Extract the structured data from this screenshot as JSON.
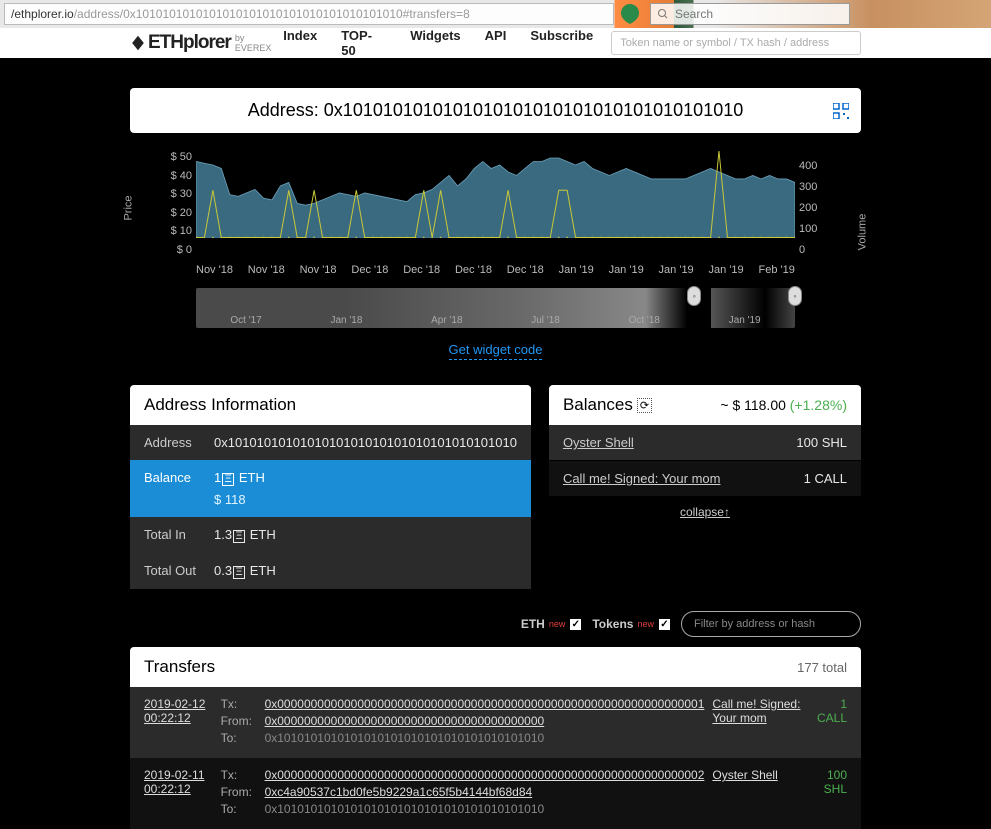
{
  "browser": {
    "url_prefix": "/ethplorer.io",
    "url_path": "/address/0x1010101010101010101010101010101010101010#transfers=8",
    "search_placeholder": "Search"
  },
  "nav": {
    "brand": "ETHplorer",
    "by": "by EVEREX",
    "items": [
      "Index",
      "TOP-50",
      "Widgets",
      "API",
      "Subscribe"
    ],
    "token_search": "Token name or symbol / TX hash / address"
  },
  "address_label": "Address:",
  "address": "0x1010101010101010101010101010101010101010",
  "widget_link": "Get widget code",
  "chart_data": {
    "type": "area+bar",
    "xlabel": "",
    "ylabel_left": "Price",
    "ylabel_right": "Volume",
    "y_left_ticks": [
      "$ 50",
      "$ 40",
      "$ 30",
      "$ 20",
      "$ 10",
      "$ 0"
    ],
    "y_right_ticks": [
      "400",
      "300",
      "200",
      "100",
      "0"
    ],
    "x_ticks": [
      "Nov '18",
      "Nov '18",
      "Nov '18",
      "Dec '18",
      "Dec '18",
      "Dec '18",
      "Dec '18",
      "Jan '19",
      "Jan '19",
      "Jan '19",
      "Jan '19",
      "Feb '19"
    ],
    "brush_ticks": [
      "Oct '17",
      "Jan '18",
      "Apr '18",
      "Jul '18",
      "Oct '18",
      "Jan '19"
    ],
    "price_series": [
      44,
      43,
      42,
      40,
      25,
      24,
      26,
      28,
      23,
      22,
      30,
      32,
      20,
      19,
      20,
      22,
      24,
      26,
      25,
      24,
      26,
      25,
      24,
      23,
      22,
      21,
      25,
      26,
      28,
      32,
      36,
      30,
      34,
      40,
      44,
      40,
      42,
      38,
      36,
      40,
      44,
      44,
      46,
      46,
      44,
      42,
      44,
      40,
      38,
      36,
      38,
      40,
      38,
      36,
      34,
      34,
      34,
      34,
      34,
      36,
      38,
      40,
      38,
      36,
      34,
      34,
      36,
      34,
      36,
      34,
      34,
      32
    ],
    "volume_spikes": [
      2,
      11,
      14,
      19,
      27,
      29,
      37,
      43,
      44,
      62
    ]
  },
  "info": {
    "title": "Address Information",
    "rows": {
      "address_lbl": "Address",
      "address_val": "0x1010101010101010101010101010101010101010",
      "balance_lbl": "Balance",
      "balance_val": "1",
      "balance_cur": "ETH",
      "balance_usd": "$ 118",
      "totalin_lbl": "Total In",
      "totalin_val": "1.3",
      "totalin_cur": "ETH",
      "totalout_lbl": "Total Out",
      "totalout_val": "0.3",
      "totalout_cur": "ETH"
    }
  },
  "balances": {
    "title": "Balances",
    "approx": "~ $ 118.00",
    "pct": "(+1.28%)",
    "items": [
      {
        "name": "Oyster Shell",
        "amount": "100 SHL"
      },
      {
        "name": "Call me! Signed: Your mom",
        "amount": "1 CALL"
      }
    ],
    "collapse": "collapse↑"
  },
  "filter": {
    "eth": "ETH",
    "tokens": "Tokens",
    "new": "new",
    "placeholder": "Filter by address or hash"
  },
  "transfers": {
    "title": "Transfers",
    "total": "177 total",
    "labels": {
      "tx": "Tx:",
      "from": "From:",
      "to": "To:"
    },
    "items": [
      {
        "date": "2019-02-12 00:22:12",
        "tx": "0x0000000000000000000000000000000000000000000000000000000000000001",
        "from": "0x0000000000000000000000000000000000000000",
        "from_link": true,
        "to": "0x1010101010101010101010101010101010101010",
        "token": "Call me! Signed: Your mom",
        "amount": "1 CALL"
      },
      {
        "date": "2019-02-11 00:22:12",
        "tx": "0x0000000000000000000000000000000000000000000000000000000000000002",
        "from": "0xc4a90537c1bd0fe5b9229a1c65f5b4144bf68d84",
        "from_link": true,
        "to": "0x1010101010101010101010101010101010101010",
        "token": "Oyster Shell",
        "amount": "100 SHL"
      }
    ]
  }
}
